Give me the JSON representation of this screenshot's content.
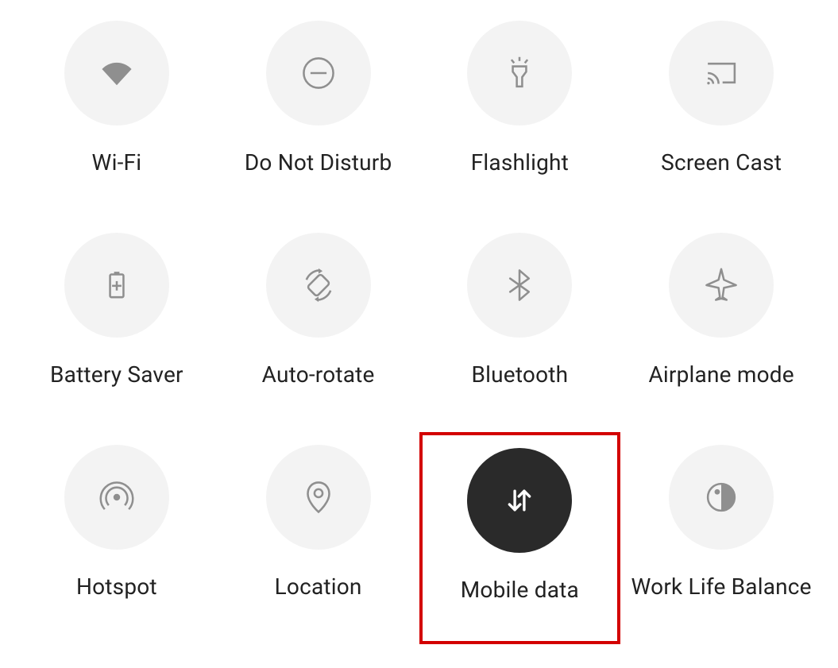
{
  "tiles": [
    {
      "id": "wifi",
      "label": "Wi-Fi",
      "active": false,
      "highlighted": false
    },
    {
      "id": "dnd",
      "label": "Do Not Disturb",
      "active": false,
      "highlighted": false
    },
    {
      "id": "flashlight",
      "label": "Flashlight",
      "active": false,
      "highlighted": false
    },
    {
      "id": "screencast",
      "label": "Screen Cast",
      "active": false,
      "highlighted": false
    },
    {
      "id": "batterysaver",
      "label": "Battery Saver",
      "active": false,
      "highlighted": false
    },
    {
      "id": "autorotate",
      "label": "Auto-rotate",
      "active": false,
      "highlighted": false
    },
    {
      "id": "bluetooth",
      "label": "Bluetooth",
      "active": false,
      "highlighted": false
    },
    {
      "id": "airplane",
      "label": "Airplane mode",
      "active": false,
      "highlighted": false
    },
    {
      "id": "hotspot",
      "label": "Hotspot",
      "active": false,
      "highlighted": false
    },
    {
      "id": "location",
      "label": "Location",
      "active": false,
      "highlighted": false
    },
    {
      "id": "mobiledata",
      "label": "Mobile data",
      "active": true,
      "highlighted": true
    },
    {
      "id": "wlb",
      "label": "Work Life Balance",
      "active": false,
      "highlighted": false
    }
  ],
  "colors": {
    "circle_bg": "#f3f3f3",
    "circle_active_bg": "#2a2a2a",
    "icon": "#8f8f8f",
    "icon_active": "#ffffff",
    "highlight_border": "#d30000"
  }
}
